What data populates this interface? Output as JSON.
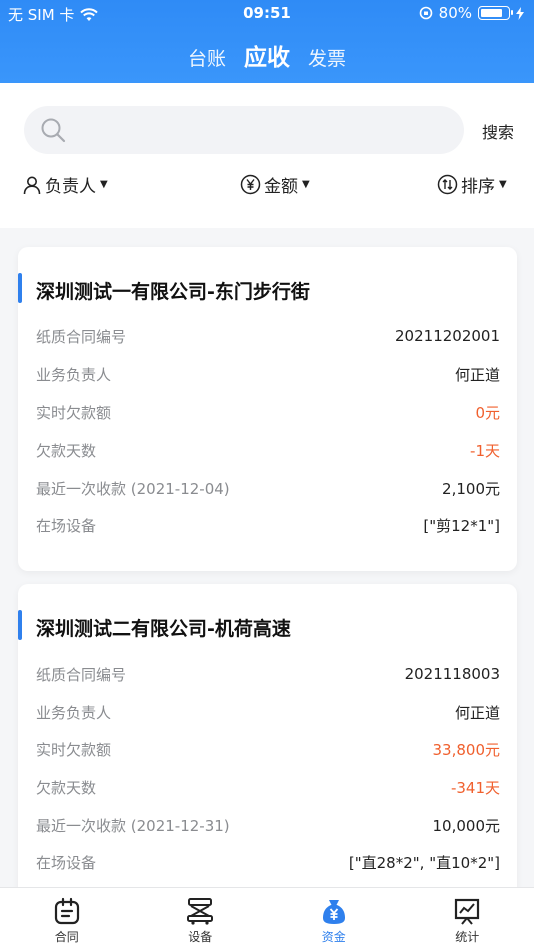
{
  "status_bar": {
    "carrier": "无 SIM 卡",
    "time": "09:51",
    "battery": "80%"
  },
  "nav": {
    "tabs": [
      "台账",
      "应收",
      "发票"
    ],
    "active_index": 1
  },
  "search": {
    "placeholder": "",
    "button_label": "搜索"
  },
  "filters": {
    "owner": "负责人",
    "amount": "金额",
    "sort": "排序"
  },
  "cards": [
    {
      "title": "深圳测试一有限公司-东门步行街",
      "rows": [
        {
          "label": "纸质合同编号",
          "value": "20211202001"
        },
        {
          "label": "业务负责人",
          "value": "何正道"
        },
        {
          "label": "实时欠款额",
          "value": "0元",
          "highlight": true
        },
        {
          "label": "欠款天数",
          "value": "-1天",
          "highlight": true
        },
        {
          "label": "最近一次收款 (2021-12-04)",
          "value": "2,100元"
        },
        {
          "label": "在场设备",
          "value": "[\"剪12*1\"]"
        }
      ]
    },
    {
      "title": "深圳测试二有限公司-机荷高速",
      "rows": [
        {
          "label": "纸质合同编号",
          "value": "2021118003"
        },
        {
          "label": "业务负责人",
          "value": "何正道"
        },
        {
          "label": "实时欠款额",
          "value": "33,800元",
          "highlight": true
        },
        {
          "label": "欠款天数",
          "value": "-341天",
          "highlight": true
        },
        {
          "label": "最近一次收款 (2021-12-31)",
          "value": "10,000元"
        },
        {
          "label": "在场设备",
          "value": "[\"直28*2\", \"直10*2\"]"
        }
      ]
    }
  ],
  "tabbar": {
    "items": [
      {
        "label": "合同",
        "icon": "contract-icon"
      },
      {
        "label": "设备",
        "icon": "equipment-icon"
      },
      {
        "label": "资金",
        "icon": "funds-icon"
      },
      {
        "label": "统计",
        "icon": "statistics-icon"
      }
    ],
    "active_index": 2
  },
  "colors": {
    "brand": "#2f80ed",
    "header": "#3a96fb",
    "warning": "#f0602e"
  }
}
